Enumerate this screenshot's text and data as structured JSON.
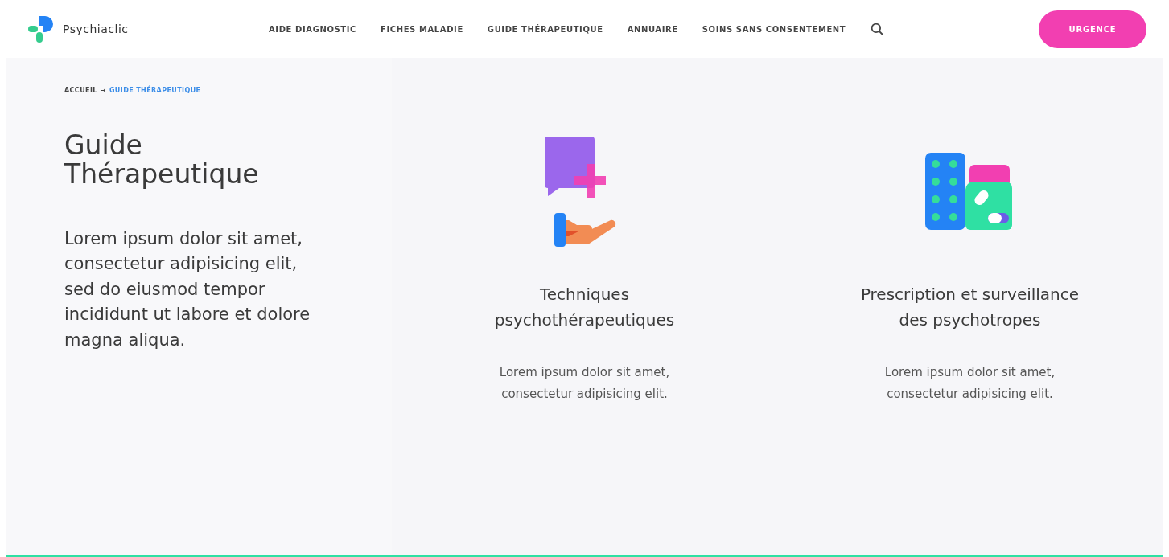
{
  "header": {
    "logo_text": "Psychiaclic",
    "nav": [
      {
        "label": "AIDE DIAGNOSTIC"
      },
      {
        "label": "FICHES MALADIE"
      },
      {
        "label": "GUIDE THÉRAPEUTIQUE"
      },
      {
        "label": "ANNUAIRE"
      },
      {
        "label": "SOINS SANS CONSENTEMENT"
      }
    ],
    "urgent_button": "URGENCE"
  },
  "breadcrumb": {
    "items": [
      {
        "label": "ACCUEIL",
        "current": false
      },
      {
        "label": "GUIDE THÉRAPEUTIQUE",
        "current": true
      }
    ],
    "separator": "→"
  },
  "intro": {
    "title": "Guide Thérapeutique",
    "text": "Lorem ipsum dolor sit amet, consectetur adipisicing elit, sed do eiusmod tempor incididunt ut labore et dolore magna aliqua."
  },
  "cards": [
    {
      "kind": "therapy",
      "title": "Techniques psychothérapeutiques",
      "text": "Lorem ipsum dolor sit amet, consectetur adipisicing elit."
    },
    {
      "kind": "pills",
      "title": "Prescription et surveillance des psychotropes",
      "text": "Lorem ipsum dolor sit amet, consectetur adipisicing elit."
    }
  ]
}
